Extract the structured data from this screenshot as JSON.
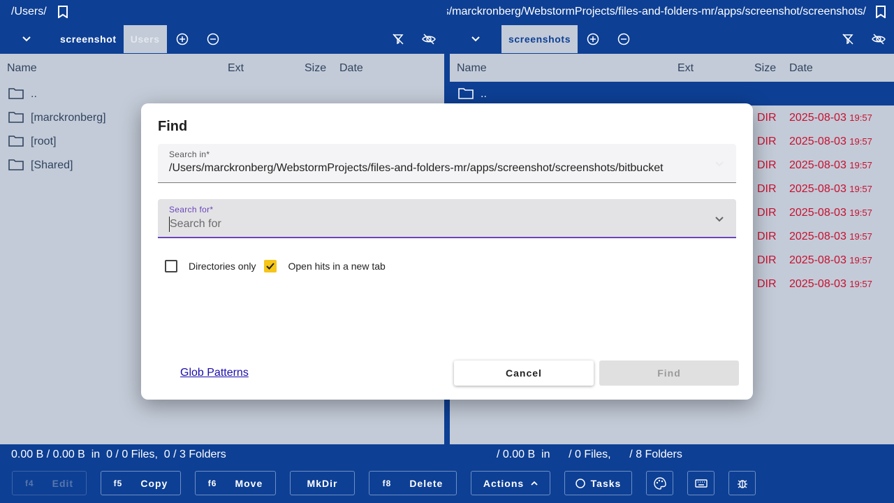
{
  "left": {
    "path": "/Users/",
    "tabs": [
      "screenshot",
      "Users"
    ],
    "columns": {
      "name": "Name",
      "ext": "Ext",
      "size": "Size",
      "date": "Date"
    },
    "rows": [
      "..",
      "[marckronberg]",
      "[root]",
      "[Shared]"
    ],
    "status": "0.00 B / 0.00 B  in  0 / 0 Files,  0 / 3 Folders"
  },
  "right": {
    "path": "/Users/marckronberg/WebstormProjects/files-and-folders-mr/apps/screenshot/screenshots/",
    "tabs": [
      "screenshots"
    ],
    "columns": {
      "name": "Name",
      "ext": "Ext",
      "size": "Size",
      "date": "Date"
    },
    "parent": "..",
    "rows": [
      {
        "size": "DIR",
        "date": "2025-08-03",
        "time": "19:57"
      },
      {
        "size": "DIR",
        "date": "2025-08-03",
        "time": "19:57"
      },
      {
        "size": "DIR",
        "date": "2025-08-03",
        "time": "19:57"
      },
      {
        "size": "DIR",
        "date": "2025-08-03",
        "time": "19:57"
      },
      {
        "size": "DIR",
        "date": "2025-08-03",
        "time": "19:57"
      },
      {
        "size": "DIR",
        "date": "2025-08-03",
        "time": "19:57"
      },
      {
        "size": "DIR",
        "date": "2025-08-03",
        "time": "19:57"
      },
      {
        "size": "DIR",
        "date": "2025-08-03",
        "time": "19:57"
      }
    ],
    "status": "/ 0.00 B  in      / 0 Files,      / 8 Folders"
  },
  "functionbar": {
    "edit": {
      "key": "f4",
      "label": "Edit"
    },
    "copy": {
      "key": "f5",
      "label": "Copy"
    },
    "move": {
      "key": "f6",
      "label": "Move"
    },
    "mkdir": {
      "label": "MkDir"
    },
    "delete": {
      "key": "f8",
      "label": "Delete"
    },
    "actions": {
      "label": "Actions"
    },
    "tasks": {
      "label": "Tasks"
    }
  },
  "dialog": {
    "title": "Find",
    "search_in": {
      "label": "Search in*",
      "value": "/Users/marckronberg/WebstormProjects/files-and-folders-mr/apps/screenshot/screenshots/bitbucket"
    },
    "search_for": {
      "label": "Search for*",
      "placeholder": "Search for",
      "value": ""
    },
    "directories_only": {
      "label": "Directories only",
      "checked": false
    },
    "open_new_tab": {
      "label": "Open hits in a new tab",
      "checked": true
    },
    "glob_link": "Glob Patterns",
    "cancel": "Cancel",
    "find": "Find"
  },
  "colors": {
    "brand": "#0d3f94",
    "panel": "#c3cbd8",
    "accent": "#6a45b8",
    "checkbox": "#f5c518",
    "date": "#c8102e"
  }
}
